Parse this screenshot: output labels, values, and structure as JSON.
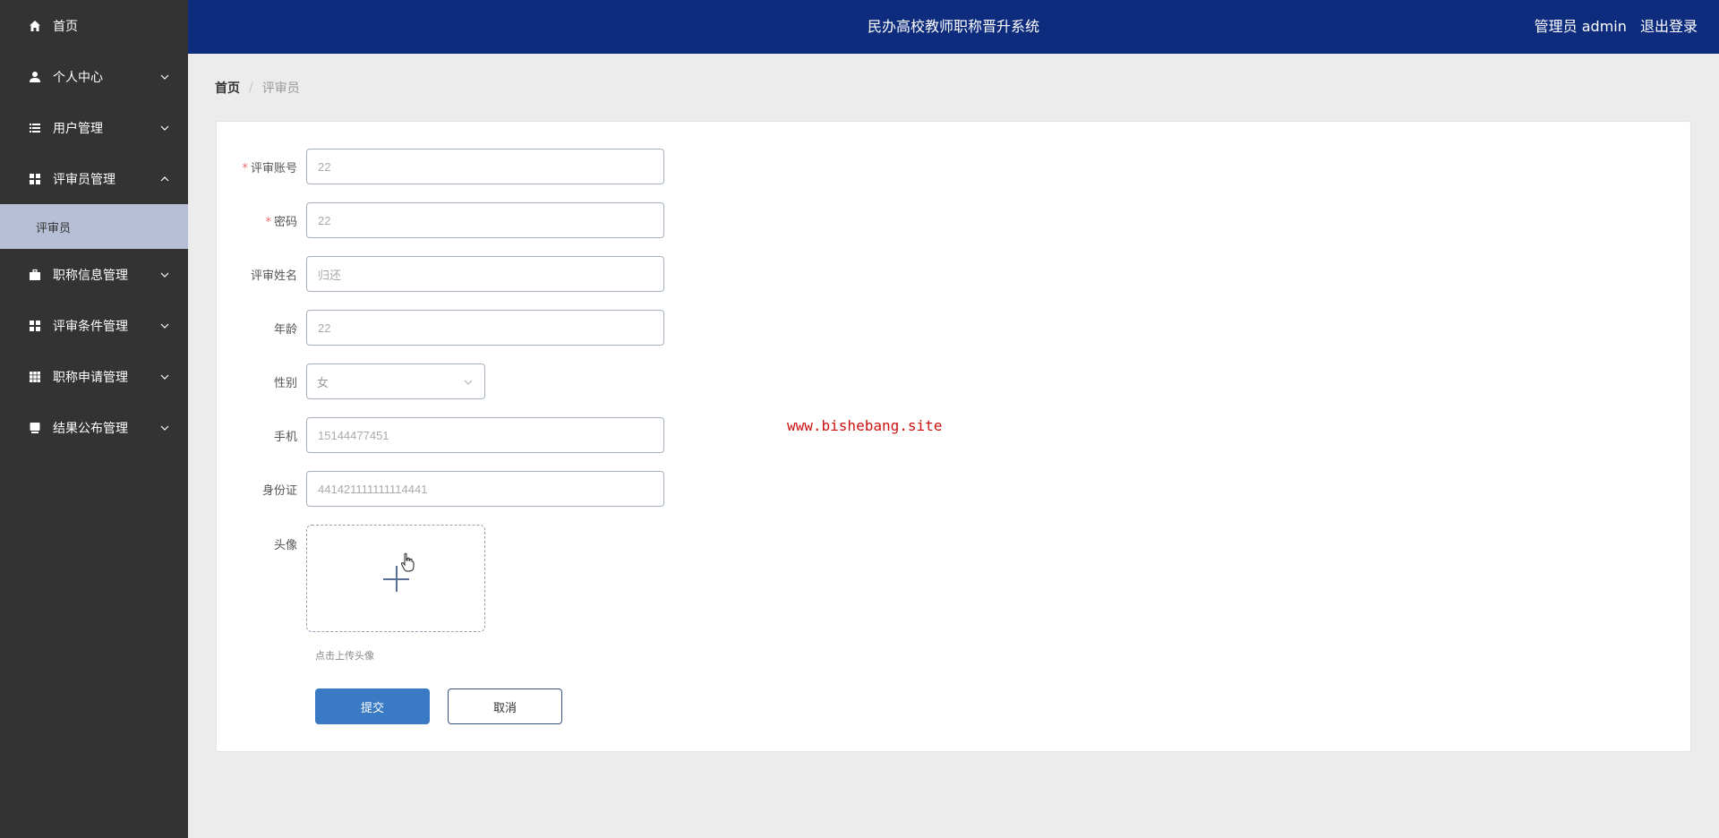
{
  "sidebar": {
    "items": [
      {
        "label": "首页",
        "icon": "home-icon",
        "chevron": ""
      },
      {
        "label": "个人中心",
        "icon": "user-icon",
        "chevron": "down"
      },
      {
        "label": "用户管理",
        "icon": "list-icon",
        "chevron": "down"
      },
      {
        "label": "评审员管理",
        "icon": "grid-icon",
        "chevron": "up"
      },
      {
        "label": "职称信息管理",
        "icon": "briefcase-icon",
        "chevron": "down"
      },
      {
        "label": "评审条件管理",
        "icon": "grid-icon",
        "chevron": "down"
      },
      {
        "label": "职称申请管理",
        "icon": "table-icon",
        "chevron": "down"
      },
      {
        "label": "结果公布管理",
        "icon": "monitor-icon",
        "chevron": "down"
      }
    ],
    "active_subitem": "评审员"
  },
  "header": {
    "system_title": "民办高校教师职称晋升系统",
    "user_label": "管理员 admin",
    "logout_label": "退出登录",
    "background_color": "#0e2c7e"
  },
  "breadcrumb": {
    "home": "首页",
    "separator": "/",
    "current": "评审员"
  },
  "form": {
    "fields": {
      "account": {
        "label": "评审账号",
        "required": true,
        "value": "22"
      },
      "password": {
        "label": "密码",
        "required": true,
        "value": "22"
      },
      "name": {
        "label": "评审姓名",
        "required": false,
        "value": "归还"
      },
      "age": {
        "label": "年龄",
        "required": false,
        "value": "22"
      },
      "gender": {
        "label": "性别",
        "required": false,
        "value": "女"
      },
      "phone": {
        "label": "手机",
        "required": false,
        "value": "15144477451"
      },
      "id_card": {
        "label": "身份证",
        "required": false,
        "value": "441421111111114441"
      },
      "avatar": {
        "label": "头像",
        "required": false,
        "tip": "点击上传头像"
      }
    },
    "submit_label": "提交",
    "cancel_label": "取消",
    "primary_color": "#3a7ac4"
  },
  "watermark": "www.bishebang.site"
}
